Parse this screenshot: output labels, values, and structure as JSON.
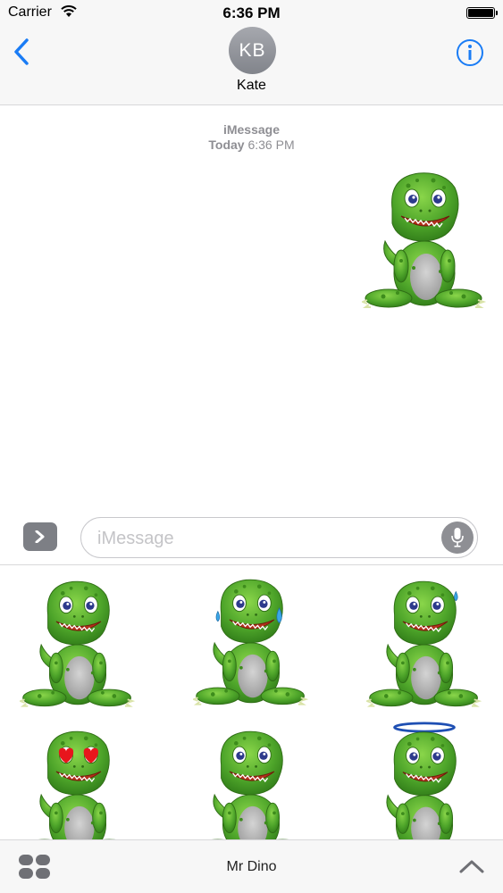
{
  "status_bar": {
    "carrier": "Carrier",
    "time": "6:36 PM",
    "battery_level": 1.0
  },
  "nav": {
    "back_icon": "chevron-left-icon",
    "avatar_initials": "KB",
    "contact_name": "Kate",
    "info_icon": "info-circle-icon",
    "accent_color": "#1a7cf5"
  },
  "conversation": {
    "service_label": "iMessage",
    "date_label": "Today",
    "time_label": "6:36 PM",
    "sent_sticker": "dino-smile"
  },
  "composer": {
    "expand_icon": "chevron-right-icon",
    "placeholder": "iMessage",
    "value": "",
    "mic_icon": "microphone-icon"
  },
  "sticker_drawer": {
    "stickers": [
      {
        "name": "dino-smile"
      },
      {
        "name": "dino-sweat-big"
      },
      {
        "name": "dino-sweat-drop"
      },
      {
        "name": "dino-heart-eyes"
      },
      {
        "name": "dino-plain"
      },
      {
        "name": "dino-halo"
      }
    ]
  },
  "bottom_bar": {
    "apps_icon": "app-drawer-icon",
    "pack_name": "Mr Dino",
    "collapse_icon": "chevron-up-icon"
  }
}
